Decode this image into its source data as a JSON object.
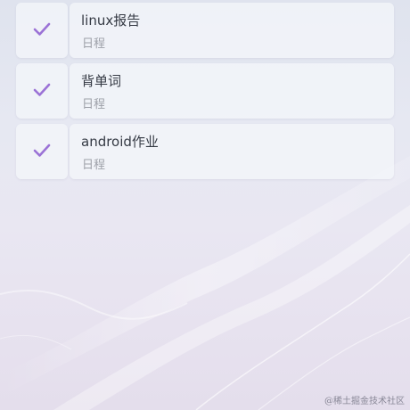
{
  "tasks": [
    {
      "title": "linux报告",
      "category": "日程",
      "done": true
    },
    {
      "title": "背单词",
      "category": "日程",
      "done": true
    },
    {
      "title": "android作业",
      "category": "日程",
      "done": true
    }
  ],
  "watermark": "@稀土掘金技术社区",
  "colors": {
    "check": "#9b72d6",
    "card": "#f4f6fa",
    "title_text": "#353a44",
    "sub_text": "#9da0a8"
  },
  "icons": {
    "check": "checkmark-icon"
  }
}
